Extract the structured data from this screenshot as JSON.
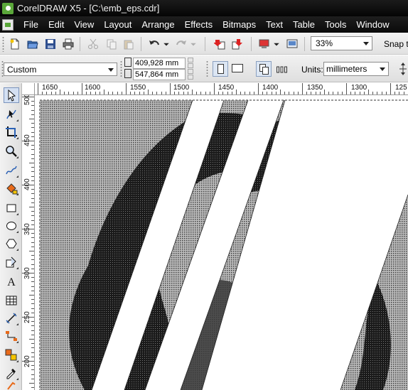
{
  "window": {
    "title": "CorelDRAW X5 - [C:\\emb_eps.cdr]"
  },
  "menu": {
    "items": [
      "File",
      "Edit",
      "View",
      "Layout",
      "Arrange",
      "Effects",
      "Bitmaps",
      "Text",
      "Table",
      "Tools",
      "Window"
    ]
  },
  "standard_toolbar": {
    "zoom_level": "33%",
    "snap_to_label": "Snap to",
    "icons": [
      "new-document-icon",
      "open-icon",
      "save-icon",
      "print-icon",
      "cut-icon",
      "copy-icon",
      "paste-icon",
      "undo-icon",
      "redo-icon",
      "import-icon",
      "export-icon",
      "application-launcher-icon",
      "welcome-screen-icon"
    ]
  },
  "property_bar": {
    "page_size_preset": "Custom",
    "width_value": "409,928 mm",
    "height_value": "547,864 mm",
    "units_label": "Units:",
    "units_value": "millimeters"
  },
  "toolbox": {
    "tools": [
      "pick-tool-icon",
      "shape-tool-icon",
      "crop-tool-icon",
      "zoom-tool-icon",
      "freehand-tool-icon",
      "smart-fill-tool-icon",
      "rectangle-tool-icon",
      "ellipse-tool-icon",
      "polygon-tool-icon",
      "basic-shapes-tool-icon",
      "text-tool-icon",
      "table-tool-icon",
      "dimension-tool-icon",
      "connector-tool-icon",
      "interactive-effects-tool-icon",
      "eyedropper-tool-icon",
      "outline-tool-icon"
    ]
  },
  "rulers": {
    "horizontal_labels": [
      "1650",
      "1600",
      "1550",
      "1500",
      "1450",
      "1400",
      "1350",
      "1300",
      "125"
    ],
    "vertical_labels": [
      "500",
      "450",
      "400",
      "350",
      "300",
      "250",
      "200"
    ]
  },
  "colors": {
    "titlebar": "#0f0f0f",
    "toolbar": "#e8e8e8",
    "canvas_fill": "#ffffff",
    "artwork_dark": "#111111",
    "artwork_mid": "#7a7a7a"
  }
}
